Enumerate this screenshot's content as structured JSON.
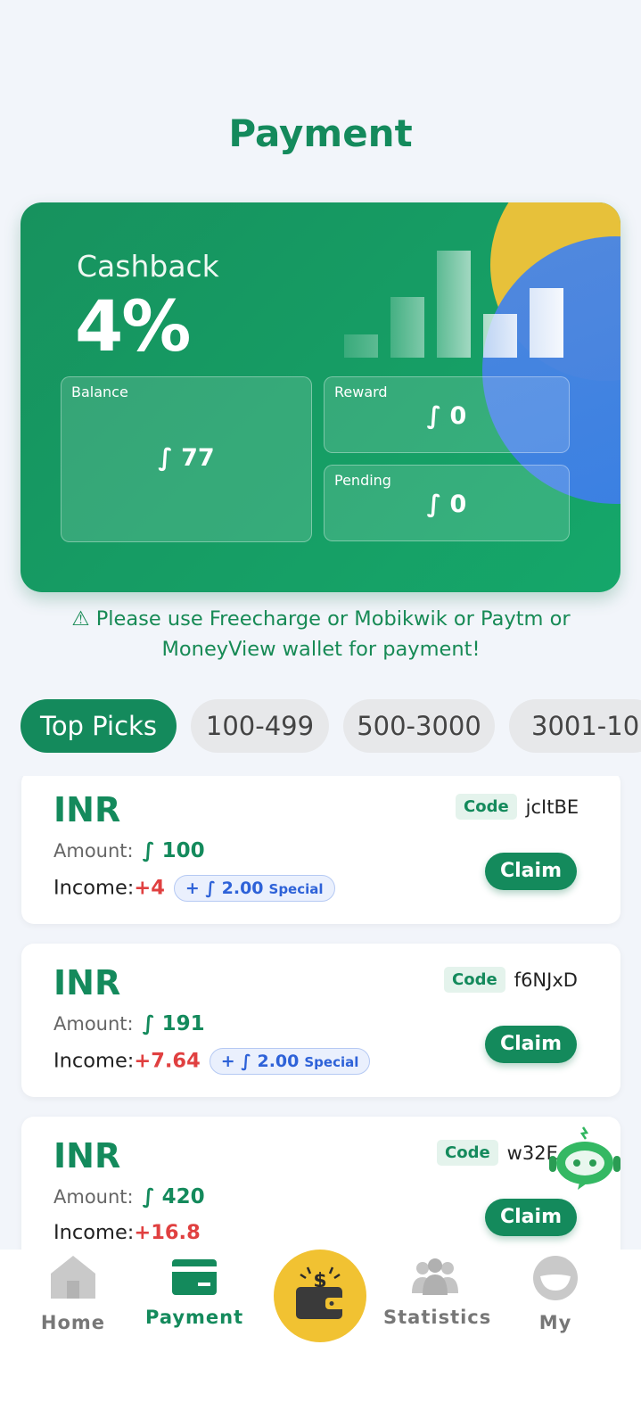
{
  "page": {
    "title": "Payment"
  },
  "cashback_card": {
    "label": "Cashback",
    "value": "4%",
    "balance": {
      "label": "Balance",
      "value": "∫ 77"
    },
    "reward": {
      "label": "Reward",
      "value": "∫ 0"
    },
    "pending": {
      "label": "Pending",
      "value": "∫ 0"
    }
  },
  "notice": "⚠ Please use Freecharge or Mobikwik or Paytm or MoneyView wallet for payment!",
  "tabs": [
    {
      "label": "Top Picks",
      "active": true
    },
    {
      "label": "100-499",
      "active": false
    },
    {
      "label": "500-3000",
      "active": false
    },
    {
      "label": "3001-10",
      "active": false
    }
  ],
  "items": [
    {
      "currency": "INR",
      "code_tag": "Code",
      "code": "jcItBE",
      "amount_label": "Amount:",
      "amount": "∫ 100",
      "income_label": "Income:",
      "income": "+4",
      "bonus": "+ ∫ 2.00",
      "bonus_tag": "Special",
      "action": "Claim"
    },
    {
      "currency": "INR",
      "code_tag": "Code",
      "code": "f6NJxD",
      "amount_label": "Amount:",
      "amount": "∫ 191",
      "income_label": "Income:",
      "income": "+7.64",
      "bonus": "+ ∫ 2.00",
      "bonus_tag": "Special",
      "action": "Claim"
    },
    {
      "currency": "INR",
      "code_tag": "Code",
      "code": "w32E",
      "amount_label": "Amount:",
      "amount": "∫ 420",
      "income_label": "Income:",
      "income": "+16.8",
      "action": "Claim"
    }
  ],
  "nav": {
    "home": "Home",
    "payment": "Payment",
    "statistics": "Statistics",
    "my": "My"
  },
  "colors": {
    "brand": "#148a5c",
    "accent": "#f1c232",
    "income": "#e04040",
    "special": "#2e62d8"
  }
}
